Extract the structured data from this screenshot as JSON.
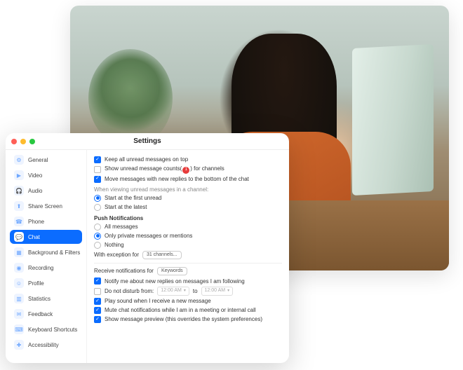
{
  "window": {
    "title": "Settings"
  },
  "sidebar": {
    "items": [
      {
        "label": "General",
        "glyph": "⚙"
      },
      {
        "label": "Video",
        "glyph": "▶"
      },
      {
        "label": "Audio",
        "glyph": "🎧"
      },
      {
        "label": "Share Screen",
        "glyph": "⬆"
      },
      {
        "label": "Phone",
        "glyph": "☎"
      },
      {
        "label": "Chat",
        "glyph": "💬",
        "active": true
      },
      {
        "label": "Background & Filters",
        "glyph": "▦"
      },
      {
        "label": "Recording",
        "glyph": "◉"
      },
      {
        "label": "Profile",
        "glyph": "☺"
      },
      {
        "label": "Statistics",
        "glyph": "▥"
      },
      {
        "label": "Feedback",
        "glyph": "✉"
      },
      {
        "label": "Keyboard Shortcuts",
        "glyph": "⌨"
      },
      {
        "label": "Accessibility",
        "glyph": "✚"
      }
    ]
  },
  "content": {
    "keep_unread_top": "Keep all unread messages on top",
    "show_unread_counts_pre": "Show unread message counts(",
    "show_unread_counts_badge": "1",
    "show_unread_counts_post": ") for channels",
    "move_replies_bottom": "Move messages with new replies to the bottom of the chat",
    "viewing_header": "When viewing unread messages in a channel:",
    "start_first_unread": "Start at the first unread",
    "start_latest": "Start at the latest",
    "push_header": "Push Notifications",
    "push_all": "All messages",
    "push_private": "Only private messages or mentions",
    "push_nothing": "Nothing",
    "exception_label": "With exception for",
    "exception_pill": "31 channels...",
    "receive_label": "Receive notifications for",
    "receive_pill": "Keywords",
    "notify_replies": "Notify me about new replies on messages I am following",
    "dnd_label": "Do not disturb from:",
    "dnd_from": "12:00 AM",
    "dnd_to_word": "to",
    "dnd_to": "12:00 AM",
    "play_sound": "Play sound when I receive a new message",
    "mute_in_meeting": "Mute chat notifications while I am in a meeting or internal call",
    "show_preview": "Show message preview (this overrides the system preferences)"
  }
}
